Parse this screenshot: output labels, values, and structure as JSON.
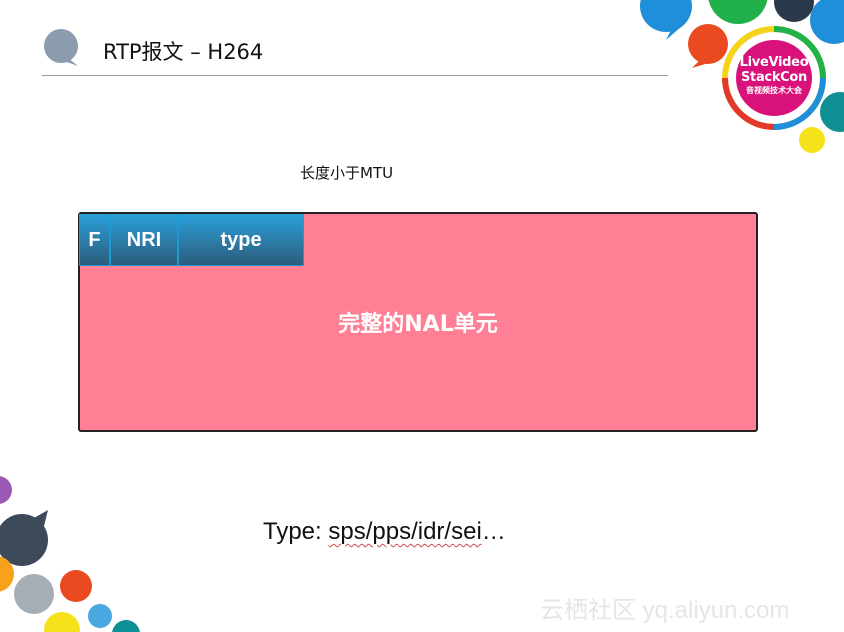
{
  "slide": {
    "title": "RTP报文 – H264",
    "length_label": "长度小于MTU",
    "header_fields": {
      "f": "F",
      "nri": "NRI",
      "type": "type"
    },
    "payload_label": "完整的NAL单元",
    "type_line": {
      "prefix": "Type: ",
      "values": "sps/pps/idr/sei",
      "suffix": "…"
    }
  },
  "logo": {
    "line1": "LiveVideo",
    "line2": "StackCon",
    "line3": "音视频技术大会"
  },
  "watermark": "云栖社区 yq.aliyun.com",
  "colors": {
    "payload": "#ff7f95",
    "header_gradient_top": "#2a9fd8",
    "header_gradient_bottom": "#2d5c7c",
    "title_bubble": "#8a9cae"
  }
}
